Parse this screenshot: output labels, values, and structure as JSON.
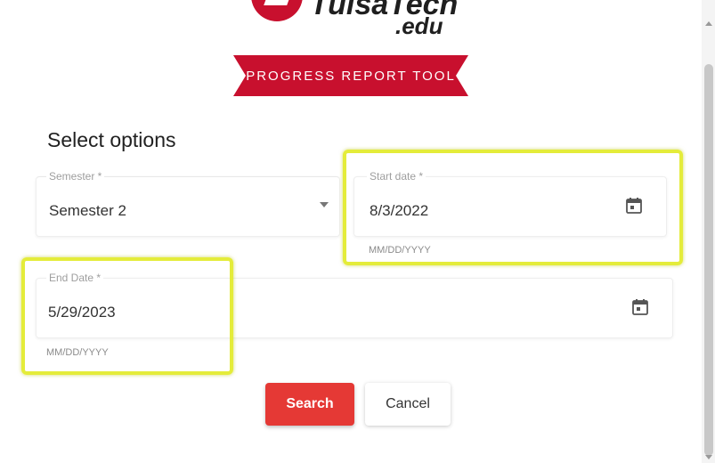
{
  "logo": {
    "name_text": "TulsaTech",
    "suffix": ".edu",
    "accent_color": "#c8102e"
  },
  "banner": {
    "text": "PROGRESS REPORT TOOL",
    "color": "#c8102e"
  },
  "form": {
    "title": "Select options",
    "semester": {
      "label": "Semester *",
      "value": "Semester 2"
    },
    "start_date": {
      "label": "Start date *",
      "value": "8/3/2022",
      "helper": "MM/DD/YYYY",
      "icon": "calendar-icon"
    },
    "end_date": {
      "label": "End Date *",
      "value": "5/29/2023",
      "helper": "MM/DD/YYYY",
      "icon": "calendar-icon"
    }
  },
  "actions": {
    "search_label": "Search",
    "cancel_label": "Cancel",
    "primary_color": "#e53935"
  },
  "annotation": {
    "highlight_color": "#e4ec3a"
  }
}
